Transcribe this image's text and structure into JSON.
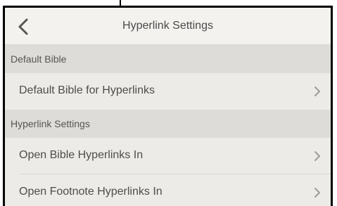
{
  "header": {
    "title": "Hyperlink Settings",
    "back_icon": "chevron-left-icon"
  },
  "sections": [
    {
      "title": "Default Bible",
      "rows": [
        {
          "label": "Default Bible for Hyperlinks"
        }
      ]
    },
    {
      "title": "Hyperlink Settings",
      "rows": [
        {
          "label": "Open Bible Hyperlinks In"
        },
        {
          "label": "Open Footnote Hyperlinks In"
        }
      ]
    }
  ],
  "colors": {
    "background": "#ecebe7",
    "section_bg": "#dedcd8",
    "header_bg": "#f3f2ef",
    "text": "#4d4d4d",
    "chevron": "#9b9b9b"
  }
}
